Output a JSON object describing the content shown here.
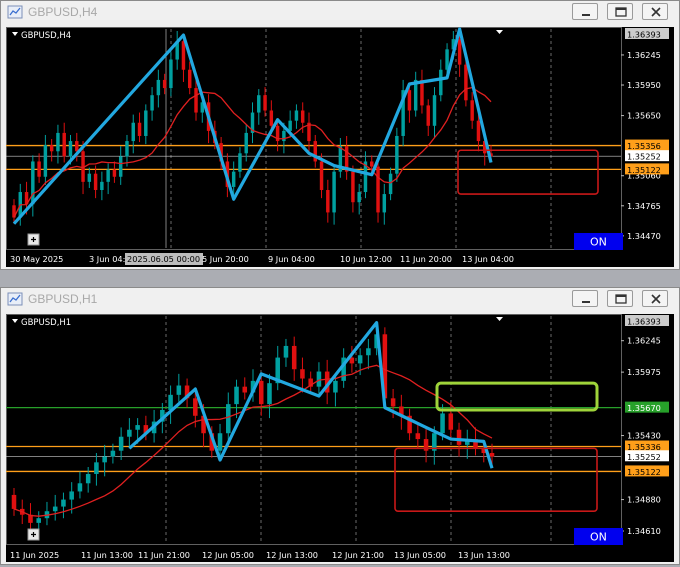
{
  "colors": {
    "bull": "#00a0a0",
    "bear": "#e01010",
    "ma": "#e02020",
    "zigzag": "#22a8e0",
    "orange_line": "#ff9f1a",
    "green_line": "#27a02a",
    "box_red": "#c81818",
    "box_green": "#9fd43a",
    "on_button": "#0000ee"
  },
  "windows": [
    {
      "title": "GBPUSD,H4",
      "symbol_label": "GBPUSD,H4",
      "price_min": 1.344,
      "price_max": 1.3648,
      "price_labels": [
        "1.36393",
        "1.36245",
        "1.35950",
        "1.35650",
        "1.35356",
        "1.35252",
        "1.35122",
        "1.35060",
        "1.34765",
        "1.34470"
      ],
      "price_tags": [
        {
          "text": "1.36393",
          "style": "gray"
        },
        {
          "text": "1.35356",
          "style": "orange"
        },
        {
          "text": "1.35252",
          "style": "white"
        },
        {
          "text": "1.35122",
          "style": "orange"
        }
      ],
      "time_labels": [
        "30 May 2025",
        "3 Jun 04:00",
        "2025.06.05 00:00",
        "5 Jun 20:00",
        "9 Jun 04:00",
        "10 Jun 12:00",
        "11 Jun 20:00",
        "13 Jun 04:00"
      ],
      "on_label": "ON",
      "hlines": [
        {
          "price": 1.35356,
          "color": "orange"
        },
        {
          "price": 1.35122,
          "color": "orange"
        }
      ],
      "boxes": [
        {
          "color": "red",
          "price_top": 1.3531,
          "price_bottom": 1.3488
        }
      ],
      "ohlc_seed": {
        "closes": [
          1.3465,
          1.349,
          1.3478,
          1.352,
          1.3505,
          1.3536,
          1.353,
          1.3548,
          1.3525,
          1.354,
          1.353,
          1.35,
          1.3508,
          1.3492,
          1.35,
          1.3512,
          1.3505,
          1.3525,
          1.354,
          1.3558,
          1.3545,
          1.357,
          1.3585,
          1.36,
          1.3592,
          1.362,
          1.3638,
          1.361,
          1.3592,
          1.3568,
          1.3578,
          1.355,
          1.3538,
          1.352,
          1.3495,
          1.351,
          1.3528,
          1.3548,
          1.3568,
          1.3585,
          1.357,
          1.3555,
          1.354,
          1.355,
          1.356,
          1.357,
          1.3558,
          1.354,
          1.352,
          1.3492,
          1.347,
          1.351,
          1.3535,
          1.351,
          1.348,
          1.349,
          1.352,
          1.3515,
          1.347,
          1.3488,
          1.3508,
          1.3545,
          1.359,
          1.357,
          1.36,
          1.3575,
          1.3555,
          1.3585,
          1.361,
          1.363,
          1.364,
          1.3615,
          1.358,
          1.356,
          1.354,
          1.3528,
          1.3525
        ],
        "zigzag_idx": [
          0,
          27,
          35,
          42,
          47,
          51,
          57,
          63,
          69,
          71,
          76
        ]
      }
    },
    {
      "title": "GBPUSD,H1",
      "symbol_label": "GBPUSD,H1",
      "price_min": 1.3455,
      "price_max": 1.3644,
      "price_labels": [
        "1.36393",
        "1.36245",
        "1.35975",
        "1.35670",
        "1.35430",
        "1.35336",
        "1.35252",
        "1.35122",
        "1.34880",
        "1.34610"
      ],
      "price_tags": [
        {
          "text": "1.36393",
          "style": "gray"
        },
        {
          "text": "1.35670",
          "style": "green"
        },
        {
          "text": "1.35336",
          "style": "orange"
        },
        {
          "text": "1.35252",
          "style": "white"
        },
        {
          "text": "1.35122",
          "style": "orange"
        }
      ],
      "time_labels": [
        "11 Jun 2025",
        "11 Jun 13:00",
        "11 Jun 21:00",
        "12 Jun 05:00",
        "12 Jun 13:00",
        "12 Jun 21:00",
        "13 Jun 05:00",
        "13 Jun 13:00"
      ],
      "on_label": "ON",
      "hlines": [
        {
          "price": 1.3567,
          "color": "green"
        },
        {
          "price": 1.35336,
          "color": "orange"
        },
        {
          "price": 1.35122,
          "color": "orange"
        }
      ],
      "boxes": [
        {
          "color": "green",
          "price_top": 1.3588,
          "price_bottom": 1.3565
        },
        {
          "color": "red",
          "price_top": 1.3532,
          "price_bottom": 1.3478
        }
      ],
      "ohlc_seed": {
        "closes": [
          1.348,
          1.3475,
          1.3468,
          1.3472,
          1.3478,
          1.3482,
          1.3488,
          1.3495,
          1.3502,
          1.351,
          1.352,
          1.3525,
          1.353,
          1.3542,
          1.3548,
          1.3552,
          1.3545,
          1.3555,
          1.3565,
          1.3578,
          1.3586,
          1.3575,
          1.356,
          1.3545,
          1.353,
          1.3545,
          1.357,
          1.3585,
          1.358,
          1.359,
          1.357,
          1.3588,
          1.361,
          1.362,
          1.36,
          1.3592,
          1.3585,
          1.3598,
          1.358,
          1.359,
          1.361,
          1.3605,
          1.3612,
          1.3618,
          1.363,
          1.3575,
          1.3568,
          1.356,
          1.3545,
          1.354,
          1.353,
          1.3545,
          1.3562,
          1.3548,
          1.3535,
          1.354,
          1.3532,
          1.3528,
          1.3525
        ],
        "zigzag_idx": [
          14,
          22,
          25,
          30,
          37,
          44,
          45,
          50,
          53,
          57,
          58
        ]
      }
    }
  ]
}
